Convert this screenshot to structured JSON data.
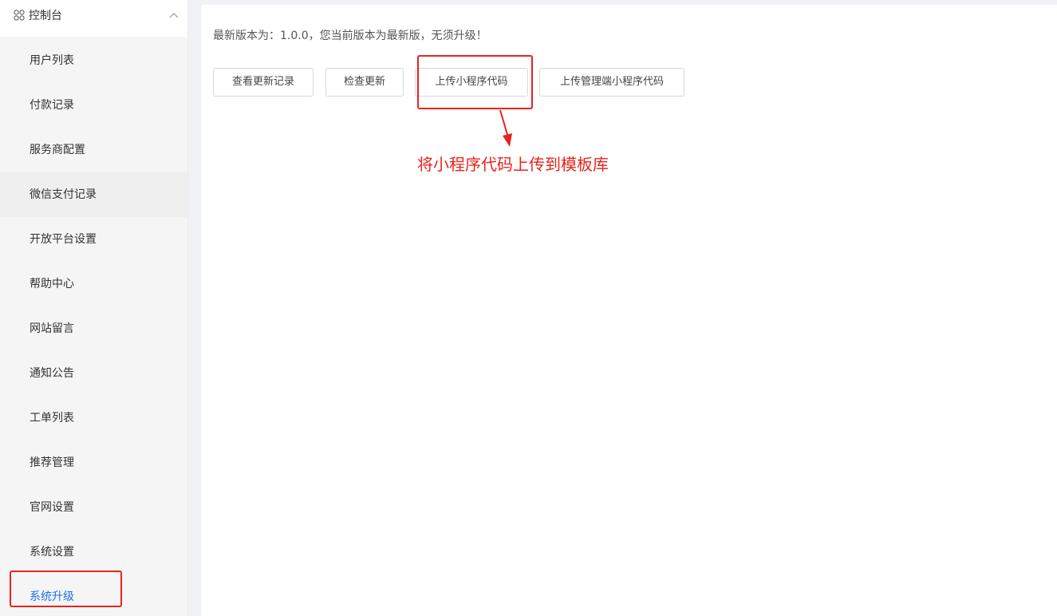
{
  "sidebar": {
    "header_title": "控制台",
    "items": [
      {
        "label": "用户列表"
      },
      {
        "label": "付款记录"
      },
      {
        "label": "服务商配置"
      },
      {
        "label": "微信支付记录"
      },
      {
        "label": "开放平台设置"
      },
      {
        "label": "帮助中心"
      },
      {
        "label": "网站留言"
      },
      {
        "label": "通知公告"
      },
      {
        "label": "工单列表"
      },
      {
        "label": "推荐管理"
      },
      {
        "label": "官网设置"
      },
      {
        "label": "系统设置"
      },
      {
        "label": "系统升级"
      }
    ],
    "active_item": "系统升级"
  },
  "main": {
    "version_text": "最新版本为：1.0.0，您当前版本为最新版，无须升级！",
    "buttons": {
      "view_log": "查看更新记录",
      "check_update": "检查更新",
      "upload_miniprogram": "上传小程序代码",
      "upload_admin_miniprogram": "上传管理端小程序代码"
    }
  },
  "annotation": {
    "label": "将小程序代码上传到模板库",
    "color": "#e8231d"
  },
  "colors": {
    "active_menu_text": "#1e6fe8",
    "annotation_red": "#e8231d",
    "sidebar_bg": "#f5f5f5"
  }
}
